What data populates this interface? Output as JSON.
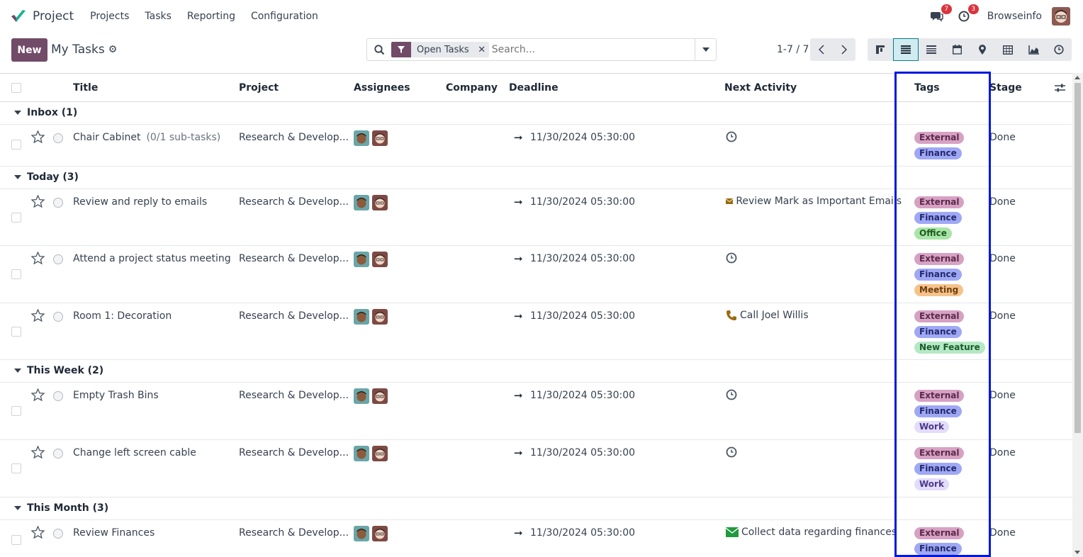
{
  "navbar": {
    "app_name": "Project",
    "menu": [
      "Projects",
      "Tasks",
      "Reporting",
      "Configuration"
    ],
    "messages_count": "7",
    "activities_count": "3",
    "user_name": "Browseinfo"
  },
  "control_panel": {
    "new_label": "New",
    "title": "My Tasks",
    "facet_label": "Open Tasks",
    "search_placeholder": "Search...",
    "pager": "1-7 / 7"
  },
  "columns": {
    "title": "Title",
    "project": "Project",
    "assignees": "Assignees",
    "company": "Company",
    "deadline": "Deadline",
    "next_activity": "Next Activity",
    "tags": "Tags",
    "stage": "Stage"
  },
  "groups": [
    {
      "label": "Inbox (1)"
    },
    {
      "label": "Today (3)"
    },
    {
      "label": "This Week (2)"
    },
    {
      "label": "This Month (3)"
    }
  ],
  "rows": [
    {
      "title": "Chair Cabinet",
      "subtasks": "(0/1 sub-tasks)",
      "project": "Research & Develop...",
      "deadline": "11/30/2024 05:30:00",
      "activity": "",
      "activity_icon": "clock-icon",
      "tags": [
        "External",
        "Finance"
      ],
      "stage": "Done"
    },
    {
      "title": "Review and reply to emails",
      "subtasks": "",
      "project": "Research & Develop...",
      "deadline": "11/30/2024 05:30:00",
      "activity": "Review Mark as Important Emails",
      "activity_icon": "email-icon",
      "tags": [
        "External",
        "Finance",
        "Office"
      ],
      "stage": "Done"
    },
    {
      "title": "Attend a project status meeting",
      "subtasks": "",
      "project": "Research & Develop...",
      "deadline": "11/30/2024 05:30:00",
      "activity": "",
      "activity_icon": "clock-icon",
      "tags": [
        "External",
        "Finance",
        "Meeting"
      ],
      "stage": "Done"
    },
    {
      "title": "Room 1: Decoration",
      "subtasks": "",
      "project": "Research & Develop...",
      "deadline": "11/30/2024 05:30:00",
      "activity": "Call Joel Willis",
      "activity_icon": "phone-icon",
      "tags": [
        "External",
        "Finance",
        "New Feature"
      ],
      "stage": "Done"
    },
    {
      "title": "Empty Trash Bins",
      "subtasks": "",
      "project": "Research & Develop...",
      "deadline": "11/30/2024 05:30:00",
      "activity": "",
      "activity_icon": "clock-icon",
      "tags": [
        "External",
        "Finance",
        "Work"
      ],
      "stage": "Done"
    },
    {
      "title": "Change left screen cable",
      "subtasks": "",
      "project": "Research & Develop...",
      "deadline": "11/30/2024 05:30:00",
      "activity": "",
      "activity_icon": "clock-icon",
      "tags": [
        "External",
        "Finance",
        "Work"
      ],
      "stage": "Done"
    },
    {
      "title": "Review Finances",
      "subtasks": "",
      "project": "Research & Develop...",
      "deadline": "11/30/2024 05:30:00",
      "activity": "Collect data regarding finances",
      "activity_icon": "email-icon",
      "tags": [
        "External",
        "Finance"
      ],
      "stage": "Done"
    }
  ],
  "colors": {
    "brand": "#714b67",
    "highlight": "#0018e0",
    "badge": "#d9353f"
  }
}
